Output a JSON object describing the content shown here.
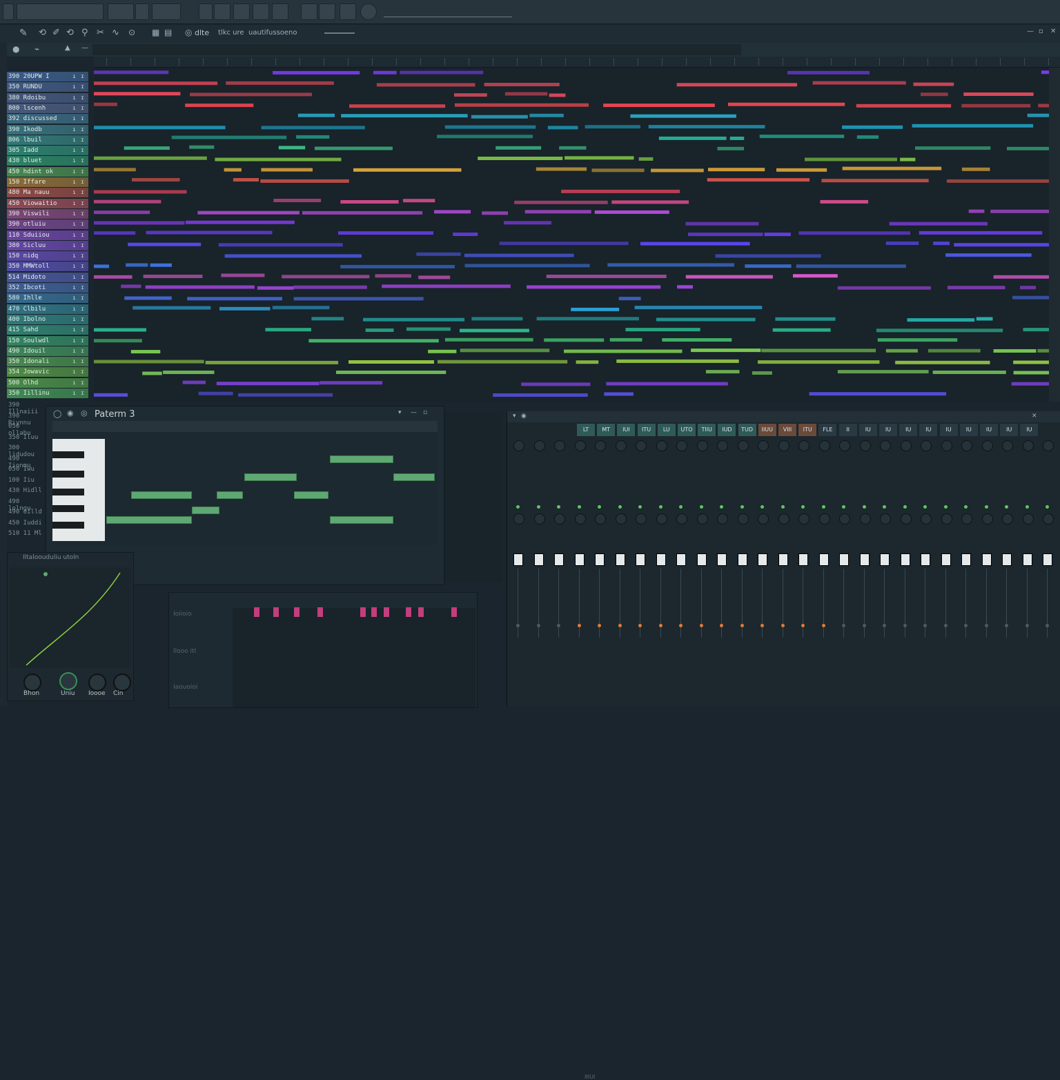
{
  "toolbar": {
    "project_name": "dlte",
    "mode_text": "tlkc ure",
    "path_text": "uautifussoeno"
  },
  "tracks": [
    {
      "label": "390 20UPW I",
      "color": "#3b5b86"
    },
    {
      "label": "350 RUNDU",
      "color": "#405880"
    },
    {
      "label": "380 Rdoibu",
      "color": "#43577d"
    },
    {
      "label": "800 lscenh",
      "color": "#485a7b"
    },
    {
      "label": "392 discussed",
      "color": "#3b6880"
    },
    {
      "label": "390 Ikodb",
      "color": "#37707c"
    },
    {
      "label": "806 lbuil",
      "color": "#347878"
    },
    {
      "label": "305 Iadd",
      "color": "#2f7f70"
    },
    {
      "label": "430 bluet",
      "color": "#2d8366"
    },
    {
      "label": "450 hdint ok",
      "color": "#47874f"
    },
    {
      "label": "150 Iffare",
      "color": "#8a6b3a"
    },
    {
      "label": "480 Ma nauu",
      "color": "#8d4a45"
    },
    {
      "label": "450 Viowaitio",
      "color": "#8f4a55"
    },
    {
      "label": "390 Viswili",
      "color": "#7c4777"
    },
    {
      "label": "390 otluiu",
      "color": "#6d4686"
    },
    {
      "label": "110 Sduiiou",
      "color": "#6a44a0"
    },
    {
      "label": "380 Sicluu",
      "color": "#6445a6"
    },
    {
      "label": "150 nidq",
      "color": "#5a48a3"
    },
    {
      "label": "350 MMWtoll",
      "color": "#4f4c9f"
    },
    {
      "label": "514 Midoto",
      "color": "#48559b"
    },
    {
      "label": "352 Ibcoti",
      "color": "#3e5f95"
    },
    {
      "label": "580 Ihlle",
      "color": "#366a8d"
    },
    {
      "label": "470 Clbilu",
      "color": "#307384"
    },
    {
      "label": "400 Ibolno",
      "color": "#2e7a7a"
    },
    {
      "label": "415 Sahd",
      "color": "#2f8070"
    },
    {
      "label": "150 Soulwdl",
      "color": "#348464"
    },
    {
      "label": "490 Idouil",
      "color": "#3d8758"
    },
    {
      "label": "350 Idonali",
      "color": "#46894d"
    },
    {
      "label": "354 Jowavic",
      "color": "#4f8a45"
    },
    {
      "label": "500 Olhd",
      "color": "#4a8b48"
    },
    {
      "label": "350 Iillinu",
      "color": "#3f8a52"
    }
  ],
  "left_labels": [
    "390 Illnaiii",
    "390 Riynnu",
    "050 ollabu",
    "350 Iluu",
    "300 lidudou",
    "490 Iionmu",
    "050 Iwu",
    "100 Iiu",
    "430 Hidll",
    "490 lolngu",
    "490 oilld",
    "450 Iuddi",
    "510 11 Ml"
  ],
  "pattern": {
    "title": "Paterm 3"
  },
  "envelope": {
    "title": "Iltaloouduliu utoln",
    "knobs": [
      "Bhon",
      "Uniu",
      "Ioooe",
      "Cin"
    ]
  },
  "steps": {
    "labels": [
      "Ioiioio",
      "Ilooo itl",
      "Iaouoioi"
    ]
  },
  "mixer": {
    "headers": [
      "LT",
      "MT",
      "IUI",
      "ITU",
      "LU",
      "UTO",
      "TIIU",
      "IUD",
      "TUD",
      "IIUU",
      "VIII",
      "ITU",
      "FLE",
      "II",
      "IU",
      "IU",
      "IU",
      "IU",
      "IU",
      "IU",
      "IU",
      "IU",
      "IU"
    ],
    "bottom_label": "IIIUI"
  },
  "colors": {
    "accent_green": "#5fa873",
    "step_pink": "#c23e7c",
    "env_line": "#8fd13b"
  }
}
